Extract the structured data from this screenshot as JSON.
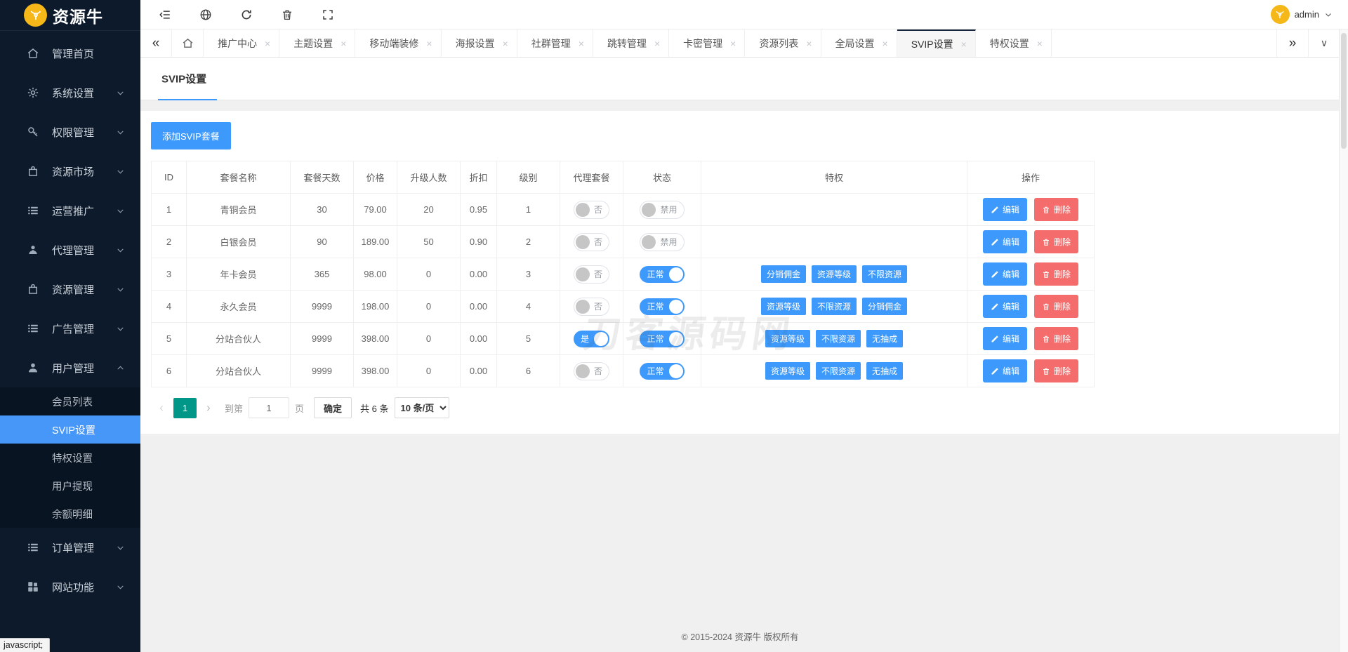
{
  "logo": {
    "text": "资源牛",
    "icon": "brand-bull-icon"
  },
  "statusbar": {
    "text": "javascript;"
  },
  "topbar": {
    "icons": [
      "collapse-icon",
      "globe-icon",
      "refresh-icon",
      "trash-icon",
      "expand-icon"
    ],
    "user": {
      "name": "admin",
      "avatar_icon": "brand-bull-icon",
      "caret_icon": "chevron-down-icon"
    }
  },
  "tabbar": {
    "left_button": "«",
    "home_icon": "home-icon",
    "tabs": [
      {
        "label": "推广中心",
        "active": false
      },
      {
        "label": "主题设置",
        "active": false
      },
      {
        "label": "移动端装修",
        "active": false
      },
      {
        "label": "海报设置",
        "active": false
      },
      {
        "label": "社群管理",
        "active": false
      },
      {
        "label": "跳转管理",
        "active": false
      },
      {
        "label": "卡密管理",
        "active": false
      },
      {
        "label": "资源列表",
        "active": false
      },
      {
        "label": "全局设置",
        "active": false
      },
      {
        "label": "SVIP设置",
        "active": true
      },
      {
        "label": "特权设置",
        "active": false
      }
    ],
    "close_glyph": "×",
    "right_buttons": [
      "»",
      "∨"
    ]
  },
  "sidebar": {
    "items": [
      {
        "label": "管理首页",
        "icon": "home-icon",
        "chevron": null
      },
      {
        "label": "系统设置",
        "icon": "gear-icon",
        "chevron": "down"
      },
      {
        "label": "权限管理",
        "icon": "key-icon",
        "chevron": "down"
      },
      {
        "label": "资源市场",
        "icon": "bag-icon",
        "chevron": "down"
      },
      {
        "label": "运营推广",
        "icon": "list-icon",
        "chevron": "down"
      },
      {
        "label": "代理管理",
        "icon": "agent-icon",
        "chevron": "down"
      },
      {
        "label": "资源管理",
        "icon": "bag-icon",
        "chevron": "down"
      },
      {
        "label": "广告管理",
        "icon": "list-icon",
        "chevron": "down"
      },
      {
        "label": "用户管理",
        "icon": "user-icon",
        "chevron": "up",
        "expanded": true,
        "children": [
          {
            "label": "会员列表",
            "active": false
          },
          {
            "label": "SVIP设置",
            "active": true
          },
          {
            "label": "特权设置",
            "active": false
          },
          {
            "label": "用户提现",
            "active": false
          },
          {
            "label": "余额明细",
            "active": false
          }
        ]
      },
      {
        "label": "订单管理",
        "icon": "list-icon",
        "chevron": "down"
      },
      {
        "label": "网站功能",
        "icon": "grid-icon",
        "chevron": "down"
      }
    ]
  },
  "page": {
    "card_tab": "SVIP设置",
    "add_button": "添加SVIP套餐",
    "watermark": "刀客源码网",
    "table": {
      "headers": [
        "ID",
        "套餐名称",
        "套餐天数",
        "价格",
        "升级人数",
        "折扣",
        "级别",
        "代理套餐",
        "状态",
        "特权",
        "操作"
      ],
      "rows": [
        {
          "id": "1",
          "name": "青铜会员",
          "days": "30",
          "price": "79.00",
          "upgrade": "20",
          "discount": "0.95",
          "level": "1",
          "agent": {
            "label": "否",
            "on": false
          },
          "status": {
            "label": "禁用",
            "on": false
          },
          "privileges": []
        },
        {
          "id": "2",
          "name": "白银会员",
          "days": "90",
          "price": "189.00",
          "upgrade": "50",
          "discount": "0.90",
          "level": "2",
          "agent": {
            "label": "否",
            "on": false
          },
          "status": {
            "label": "禁用",
            "on": false
          },
          "privileges": []
        },
        {
          "id": "3",
          "name": "年卡会员",
          "days": "365",
          "price": "98.00",
          "upgrade": "0",
          "discount": "0.00",
          "level": "3",
          "agent": {
            "label": "否",
            "on": false
          },
          "status": {
            "label": "正常",
            "on": true
          },
          "privileges": [
            "分销佣金",
            "资源等级",
            "不限资源"
          ]
        },
        {
          "id": "4",
          "name": "永久会员",
          "days": "9999",
          "price": "198.00",
          "upgrade": "0",
          "discount": "0.00",
          "level": "4",
          "agent": {
            "label": "否",
            "on": false
          },
          "status": {
            "label": "正常",
            "on": true
          },
          "privileges": [
            "资源等级",
            "不限资源",
            "分销佣金"
          ]
        },
        {
          "id": "5",
          "name": "分站合伙人",
          "days": "9999",
          "price": "398.00",
          "upgrade": "0",
          "discount": "0.00",
          "level": "5",
          "agent": {
            "label": "是",
            "on": true
          },
          "status": {
            "label": "正常",
            "on": true
          },
          "privileges": [
            "资源等级",
            "不限资源",
            "无抽成"
          ]
        },
        {
          "id": "6",
          "name": "分站合伙人",
          "days": "9999",
          "price": "398.00",
          "upgrade": "0",
          "discount": "0.00",
          "level": "6",
          "agent": {
            "label": "否",
            "on": false
          },
          "status": {
            "label": "正常",
            "on": true
          },
          "privileges": [
            "资源等级",
            "不限资源",
            "无抽成"
          ]
        }
      ]
    },
    "ops": {
      "edit": "编辑",
      "edit_icon": "pencil-icon",
      "del": "删除",
      "del_icon": "trash-icon"
    },
    "pagination": {
      "prev_icon": "‹",
      "current_page": "1",
      "next_icon": "›",
      "goto_prefix": "到第",
      "goto_value": "1",
      "goto_suffix": "页",
      "confirm": "确定",
      "total": "共 6 条",
      "page_size": "10 条/页"
    },
    "footer": "© 2015-2024 资源牛 版权所有"
  },
  "colors": {
    "accent_blue": "#3d9afc",
    "danger_red": "#f56c6c",
    "pagination_teal": "#009688",
    "sidebar_bg": "#0c1a2b",
    "sidebar_active": "#4797f8",
    "brand_yellow": "#f5b818",
    "tab_active_border": "#16243a"
  }
}
